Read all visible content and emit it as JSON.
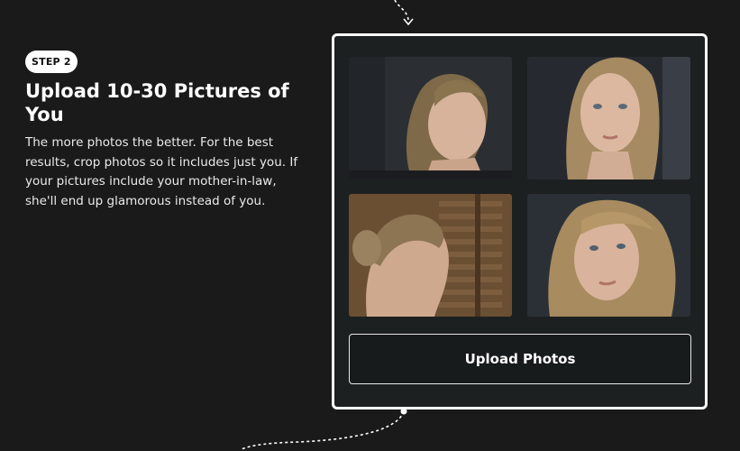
{
  "step": {
    "badge": "STEP 2",
    "title": "Upload 10-30 Pictures of You",
    "description": "The more photos the better. For the best results, crop photos so it includes just you. If your pictures include your mother-in-law, she'll end up glamorous instead of you."
  },
  "upload_card": {
    "button_label": "Upload Photos",
    "photos": [
      {
        "icon": "photo-profile-right"
      },
      {
        "icon": "photo-front-portrait"
      },
      {
        "icon": "photo-back-of-head"
      },
      {
        "icon": "photo-tilted-selfie"
      }
    ]
  },
  "colors": {
    "page_background": "#1a1a1a",
    "card_background": "#1d2020",
    "card_border": "#ffffff",
    "text": "#ffffff"
  }
}
